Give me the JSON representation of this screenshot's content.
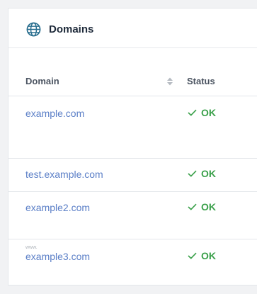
{
  "panel": {
    "title": "Domains",
    "icon": "globe-icon"
  },
  "table": {
    "columns": {
      "domain": "Domain",
      "status": "Status"
    },
    "rows": [
      {
        "prefix": "",
        "domain": "example.com",
        "status": "OK"
      },
      {
        "prefix": "",
        "domain": "test.example.com",
        "status": "OK"
      },
      {
        "prefix": "",
        "domain": "example2.com",
        "status": "OK"
      },
      {
        "prefix": "www.",
        "domain": "example3.com",
        "status": "OK"
      }
    ]
  },
  "colors": {
    "link": "#5b7fc7",
    "ok": "#3aa04a",
    "icon": "#2a6f8f"
  }
}
